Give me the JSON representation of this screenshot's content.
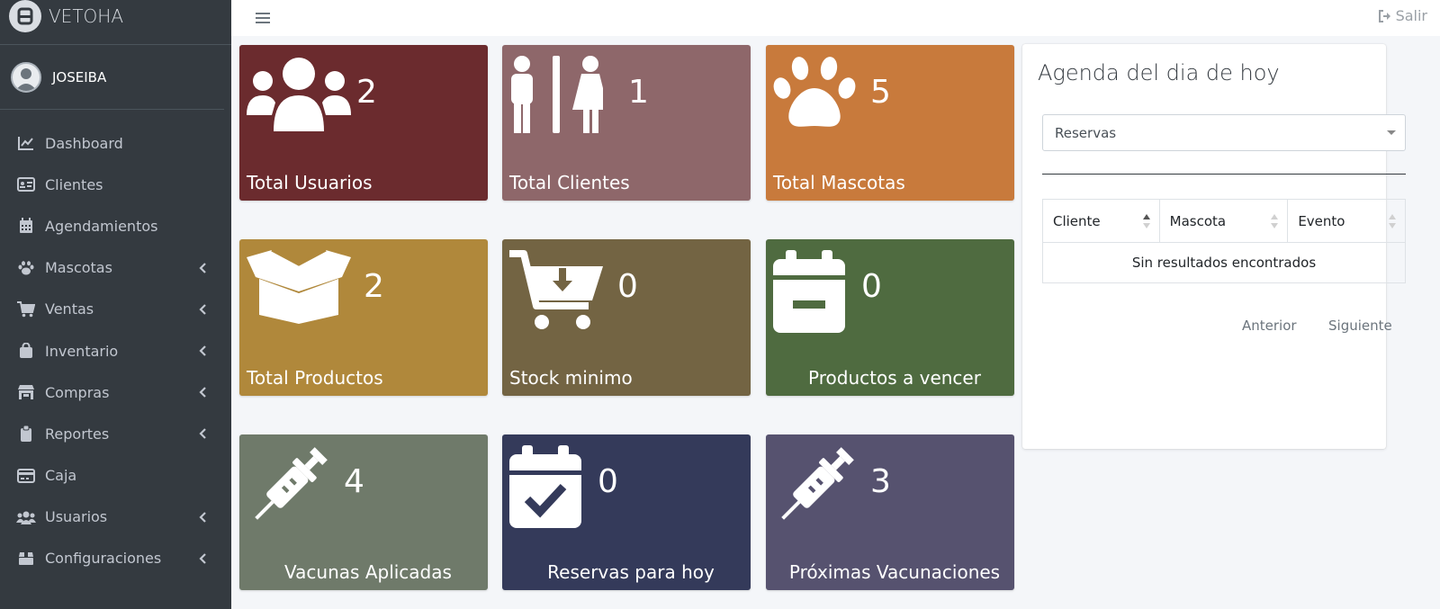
{
  "brand": {
    "name": "VETOHA"
  },
  "user": {
    "name": "JOSEIBA"
  },
  "sidebar": {
    "items": [
      {
        "label": "Dashboard",
        "icon": "chart-line-icon",
        "has_submenu": false
      },
      {
        "label": "Clientes",
        "icon": "id-card-icon",
        "has_submenu": false
      },
      {
        "label": "Agendamientos",
        "icon": "calendar-grid-icon",
        "has_submenu": false
      },
      {
        "label": "Mascotas",
        "icon": "paw-icon",
        "has_submenu": true
      },
      {
        "label": "Ventas",
        "icon": "shopping-cart-icon",
        "has_submenu": true
      },
      {
        "label": "Inventario",
        "icon": "shopping-bag-icon",
        "has_submenu": true
      },
      {
        "label": "Compras",
        "icon": "store-icon",
        "has_submenu": true
      },
      {
        "label": "Reportes",
        "icon": "clipboard-icon",
        "has_submenu": true
      },
      {
        "label": "Caja",
        "icon": "credit-card-icon",
        "has_submenu": false
      },
      {
        "label": "Usuarios",
        "icon": "users-icon",
        "has_submenu": true
      },
      {
        "label": "Configuraciones",
        "icon": "box-icon",
        "has_submenu": true
      }
    ]
  },
  "header": {
    "menu_icon": "hamburger-icon",
    "logout_label": "Salir",
    "logout_icon": "sign-out-icon"
  },
  "cards": [
    {
      "label": "Total Usuarios",
      "value": "2",
      "color": "#6b2b2e",
      "icon": "users-icon"
    },
    {
      "label": "Total Clientes",
      "value": "1",
      "color": "#8e676a",
      "icon": "restroom-icon"
    },
    {
      "label": "Total Mascotas",
      "value": "5",
      "color": "#c87a3c",
      "icon": "paw-icon"
    },
    {
      "label": "Total Productos",
      "value": "2",
      "color": "#b0883b",
      "icon": "open-box-icon"
    },
    {
      "label": "Stock minimo",
      "value": "0",
      "color": "#736443",
      "icon": "cart-download-icon"
    },
    {
      "label": "Productos a vencer",
      "value": "0",
      "color": "#4f6b40",
      "icon": "calendar-minus-icon"
    },
    {
      "label": "Vacunas Aplicadas",
      "value": "4",
      "color": "#6f7a6a",
      "icon": "syringe-icon"
    },
    {
      "label": "Reservas para hoy",
      "value": "0",
      "color": "#343a5a",
      "icon": "calendar-check-icon"
    },
    {
      "label": "Próximas Vacunaciones",
      "value": "3",
      "color": "#56526f",
      "icon": "syringe-icon"
    }
  ],
  "agenda": {
    "title": "Agenda del dia de hoy",
    "select_value": "Reservas",
    "columns": [
      "Cliente",
      "Mascota",
      "Evento"
    ],
    "empty_message": "Sin resultados encontrados",
    "prev_label": "Anterior",
    "next_label": "Siguiente"
  }
}
